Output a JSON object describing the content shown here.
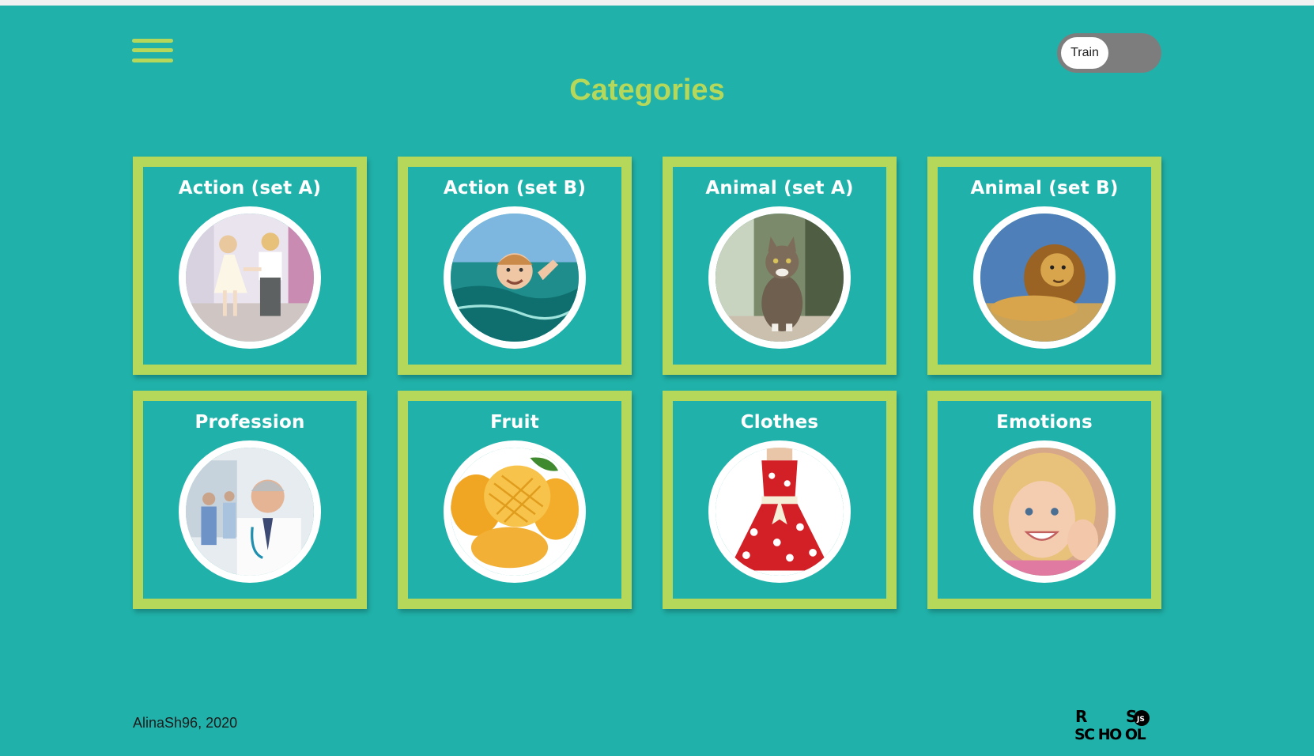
{
  "header": {
    "menu_icon": "hamburger-menu-icon",
    "title": "Categories",
    "mode_toggle": {
      "label": "Train",
      "state": "train"
    }
  },
  "categories": [
    {
      "name": "Action (set A)",
      "image": "dancing-children"
    },
    {
      "name": "Action (set B)",
      "image": "swimming-boy"
    },
    {
      "name": "Animal (set A)",
      "image": "cat"
    },
    {
      "name": "Animal (set B)",
      "image": "lion"
    },
    {
      "name": "Profession",
      "image": "doctor"
    },
    {
      "name": "Fruit",
      "image": "mangoes"
    },
    {
      "name": "Clothes",
      "image": "red-dress"
    },
    {
      "name": "Emotions",
      "image": "smiling-girl"
    }
  ],
  "footer": {
    "author": "AlinaSh96, 2020",
    "logo_text": {
      "line1_left": "R",
      "line1_right": "S",
      "line2": "SC HO OL",
      "badge": "JS"
    }
  },
  "colors": {
    "background": "#20b2aa",
    "accent": "#b6d85a",
    "card_text": "#ffffff",
    "toggle_track": "#7d7d7d"
  }
}
